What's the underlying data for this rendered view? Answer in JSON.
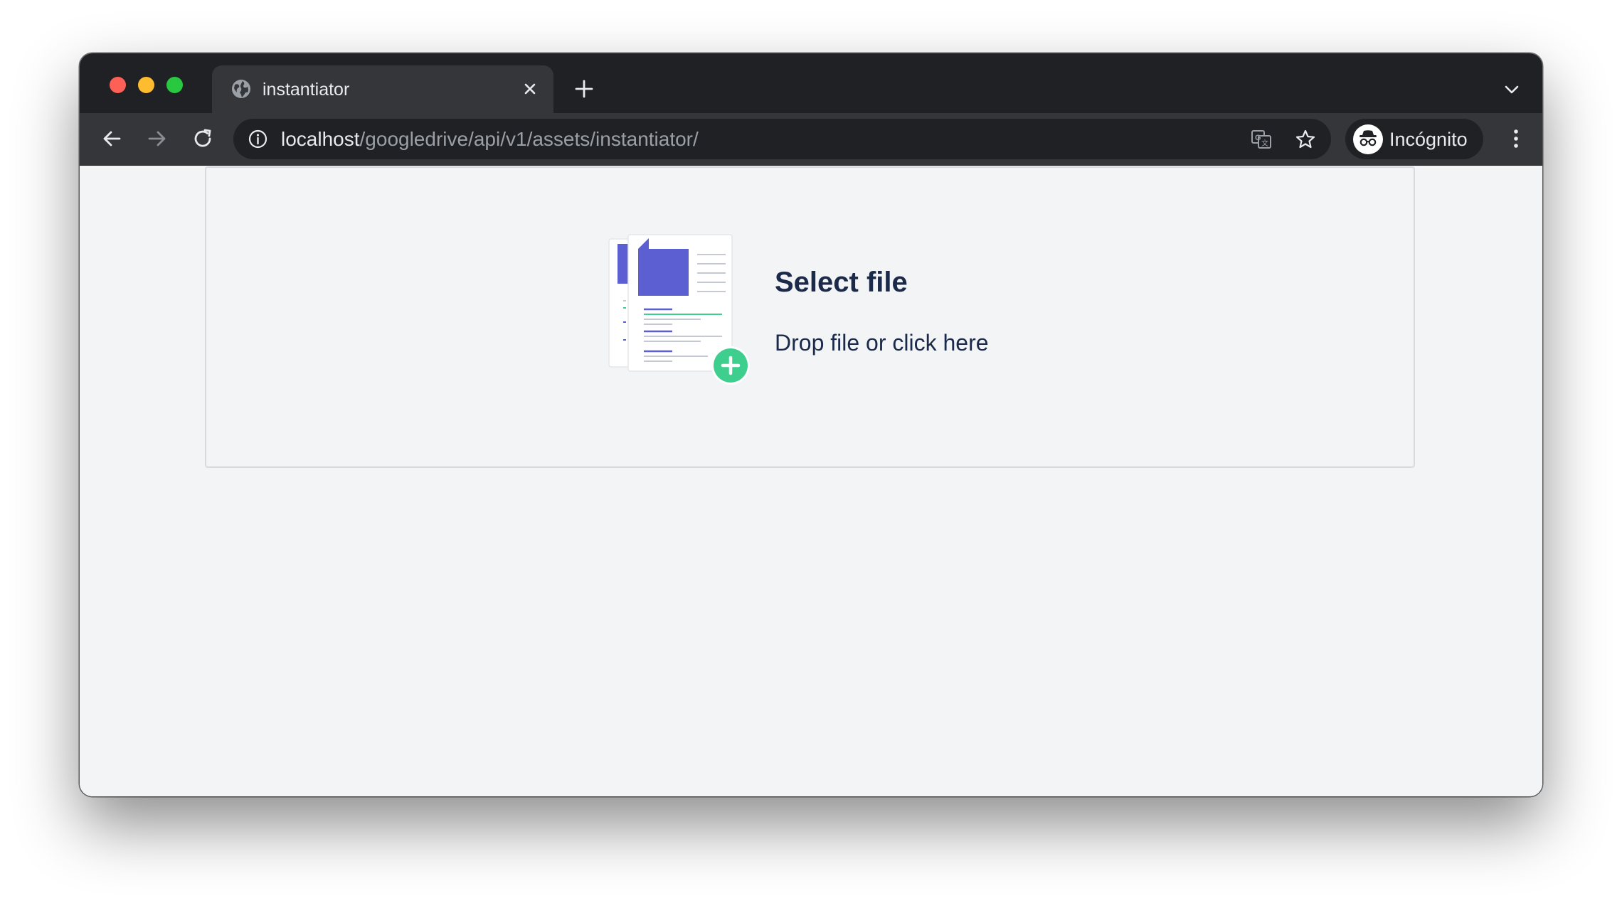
{
  "browser": {
    "tab": {
      "title": "instantiator",
      "icon": "globe-icon"
    },
    "address_bar": {
      "host": "localhost",
      "path": "/googledrive/api/v1/assets/instantiator/"
    },
    "profile": {
      "label": "Incógnito",
      "icon": "incognito-icon"
    },
    "colors": {
      "tab_strip": "#202124",
      "toolbar": "#35363a",
      "close_dot": "#fe5f57",
      "minimize_dot": "#febc2e",
      "zoom_dot": "#28c840"
    }
  },
  "page": {
    "dropzone": {
      "title": "Select file",
      "subtitle": "Drop file or click here",
      "icon": "add-file-illustration",
      "colors": {
        "accent_blue": "#5b5fd1",
        "accent_green": "#3ecf8e",
        "text": "#1b2a4a",
        "background": "#f3f4f6"
      }
    }
  }
}
